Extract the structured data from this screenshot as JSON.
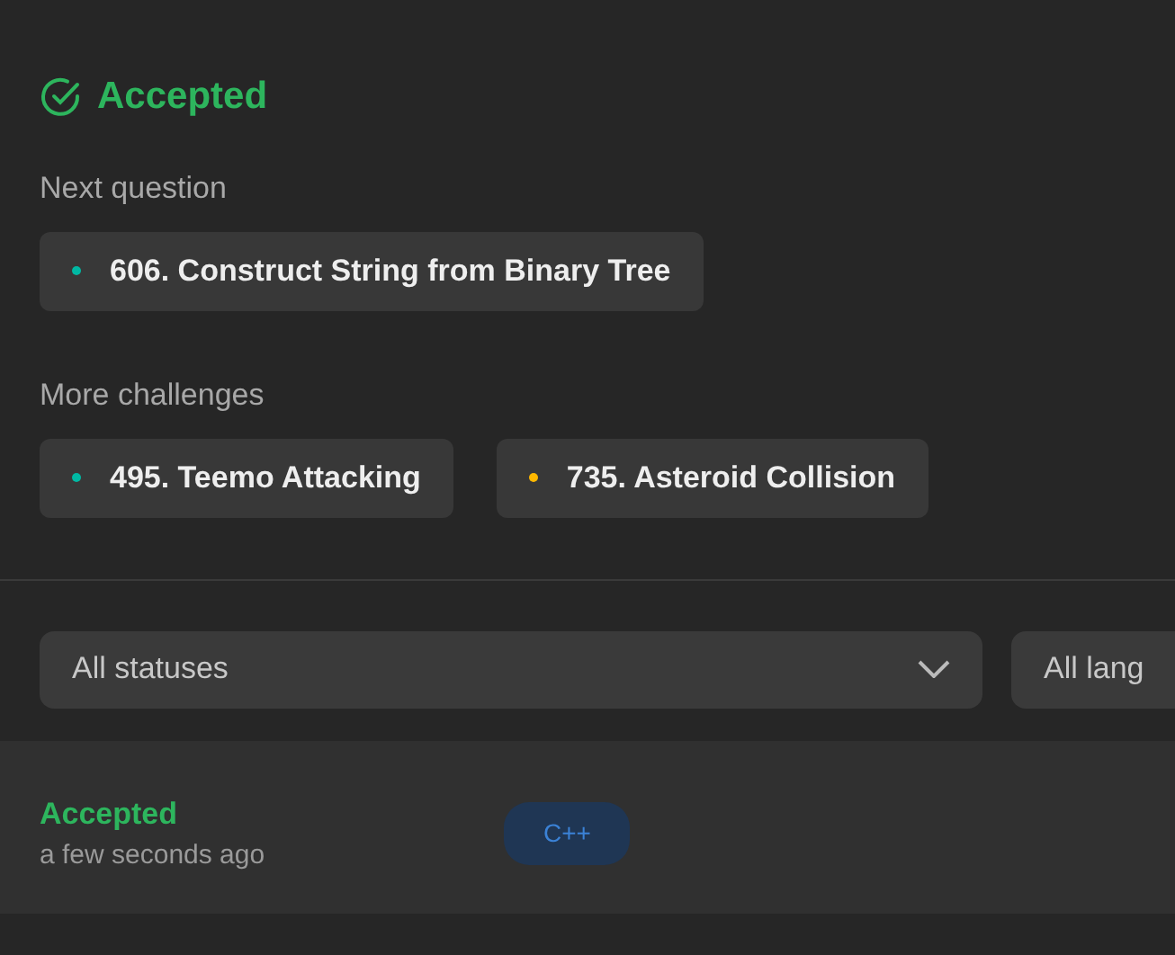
{
  "result": {
    "status": "Accepted"
  },
  "next_question": {
    "heading": "Next question",
    "items": [
      {
        "title": "606. Construct String from Binary Tree",
        "color": "#00b8a3"
      }
    ]
  },
  "more_challenges": {
    "heading": "More challenges",
    "items": [
      {
        "title": "495. Teemo Attacking",
        "color": "#00b8a3"
      },
      {
        "title": "735. Asteroid Collision",
        "color": "#ffb800"
      }
    ]
  },
  "filters": [
    {
      "value": "All statuses",
      "expanded": false
    },
    {
      "value": "All lang"
    }
  ],
  "submissions": [
    {
      "status": "Accepted",
      "time": "a few seconds ago",
      "language": "C++"
    }
  ]
}
